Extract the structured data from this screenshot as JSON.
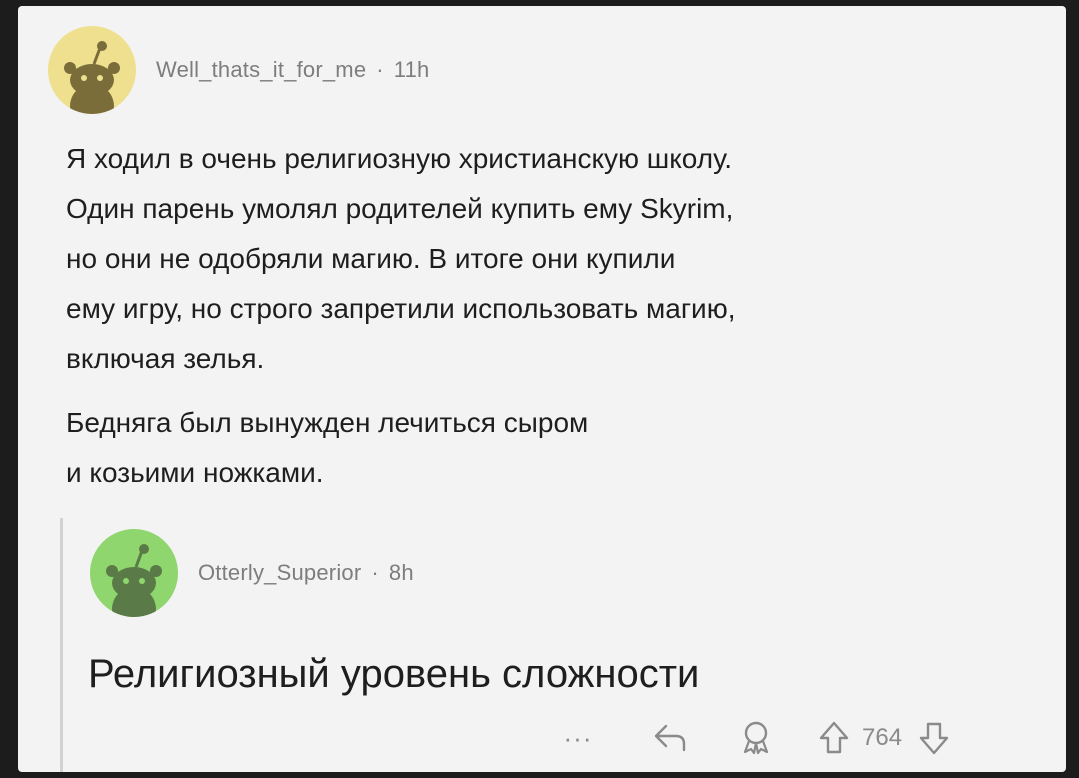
{
  "comment": {
    "author": "Well_thats_it_for_me",
    "separator": "·",
    "time": "11h",
    "paragraph1": "Я ходил в очень религиозную христианскую школу.\nОдин парень умолял родителей купить ему Skyrim,\nно они не одобряли магию. В итоге они купили\nему игру, но строго запретили использовать магию,\nвключая зелья.",
    "paragraph2": "Бедняга был вынужден лечиться сыром\nи козьими ножками."
  },
  "reply": {
    "author": "Otterly_Superior",
    "separator": "·",
    "time": "8h",
    "text": "Религиозный уровень сложности",
    "more_label": "···",
    "vote_count": "764"
  },
  "colors": {
    "comment_avatar_bg": "#efe08f",
    "reply_avatar_bg": "#8fd66e",
    "text": "#1e1e1e",
    "meta": "#7d7d7d"
  },
  "icons": [
    "snoo-avatar-icon",
    "reply-icon",
    "award-icon",
    "upvote-icon",
    "downvote-icon"
  ]
}
